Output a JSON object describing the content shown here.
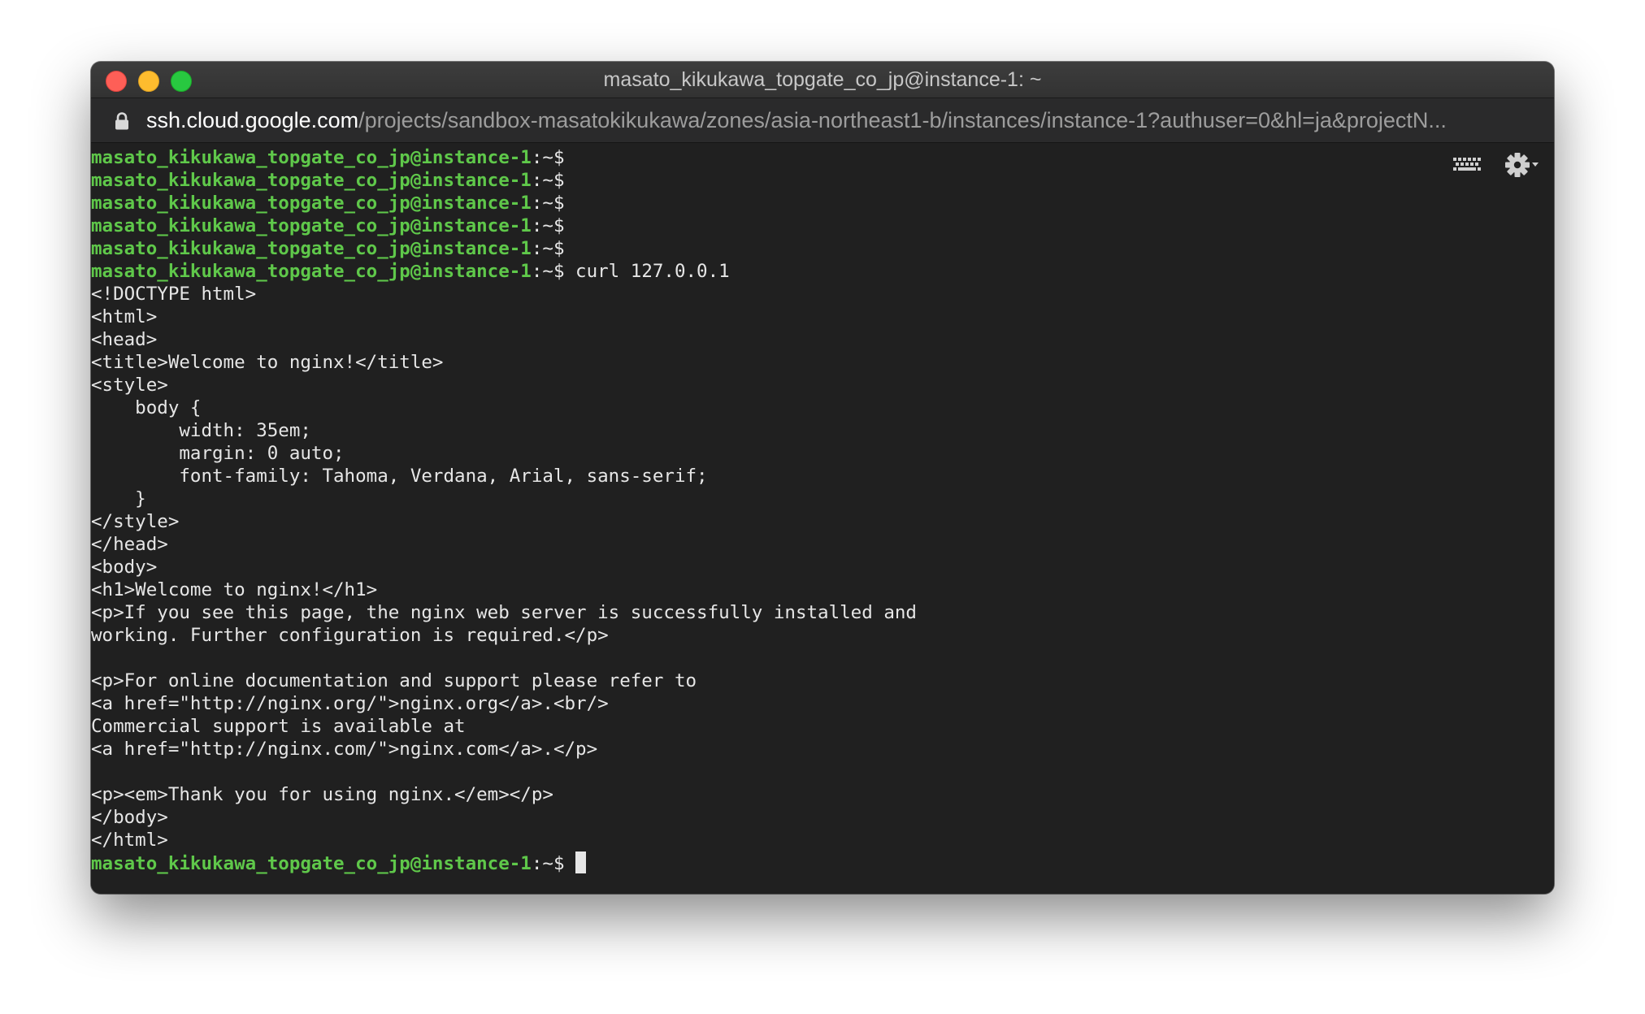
{
  "window": {
    "title": "masato_kikukawa_topgate_co_jp@instance-1: ~"
  },
  "urlbar": {
    "host": "ssh.cloud.google.com",
    "path": "/projects/sandbox-masatokikukawa/zones/asia-northeast1-b/instances/instance-1?authuser=0&hl=ja&projectN..."
  },
  "terminal": {
    "prompt_user": "masato_kikukawa_topgate_co_jp@instance-1",
    "prompt_suffix": ":~$",
    "lines": [
      {
        "type": "prompt",
        "command": ""
      },
      {
        "type": "prompt",
        "command": ""
      },
      {
        "type": "prompt",
        "command": ""
      },
      {
        "type": "prompt",
        "command": ""
      },
      {
        "type": "prompt",
        "command": ""
      },
      {
        "type": "prompt",
        "command": " curl 127.0.0.1"
      },
      {
        "type": "output",
        "text": "<!DOCTYPE html>"
      },
      {
        "type": "output",
        "text": "<html>"
      },
      {
        "type": "output",
        "text": "<head>"
      },
      {
        "type": "output",
        "text": "<title>Welcome to nginx!</title>"
      },
      {
        "type": "output",
        "text": "<style>"
      },
      {
        "type": "output",
        "text": "    body {"
      },
      {
        "type": "output",
        "text": "        width: 35em;"
      },
      {
        "type": "output",
        "text": "        margin: 0 auto;"
      },
      {
        "type": "output",
        "text": "        font-family: Tahoma, Verdana, Arial, sans-serif;"
      },
      {
        "type": "output",
        "text": "    }"
      },
      {
        "type": "output",
        "text": "</style>"
      },
      {
        "type": "output",
        "text": "</head>"
      },
      {
        "type": "output",
        "text": "<body>"
      },
      {
        "type": "output",
        "text": "<h1>Welcome to nginx!</h1>"
      },
      {
        "type": "output",
        "text": "<p>If you see this page, the nginx web server is successfully installed and"
      },
      {
        "type": "output",
        "text": "working. Further configuration is required.</p>"
      },
      {
        "type": "output",
        "text": ""
      },
      {
        "type": "output",
        "text": "<p>For online documentation and support please refer to"
      },
      {
        "type": "output",
        "text": "<a href=\"http://nginx.org/\">nginx.org</a>.<br/>"
      },
      {
        "type": "output",
        "text": "Commercial support is available at"
      },
      {
        "type": "output",
        "text": "<a href=\"http://nginx.com/\">nginx.com</a>.</p>"
      },
      {
        "type": "output",
        "text": ""
      },
      {
        "type": "output",
        "text": "<p><em>Thank you for using nginx.</em></p>"
      },
      {
        "type": "output",
        "text": "</body>"
      },
      {
        "type": "output",
        "text": "</html>"
      },
      {
        "type": "prompt",
        "command": " ",
        "cursor": true
      }
    ]
  },
  "icons": {
    "keyboard": "keyboard-icon",
    "settings": "gear-icon",
    "lock": "lock-icon"
  },
  "colors": {
    "prompt_user": "#5fc84a",
    "terminal_bg": "#202020",
    "terminal_fg": "#e6e6e6"
  }
}
